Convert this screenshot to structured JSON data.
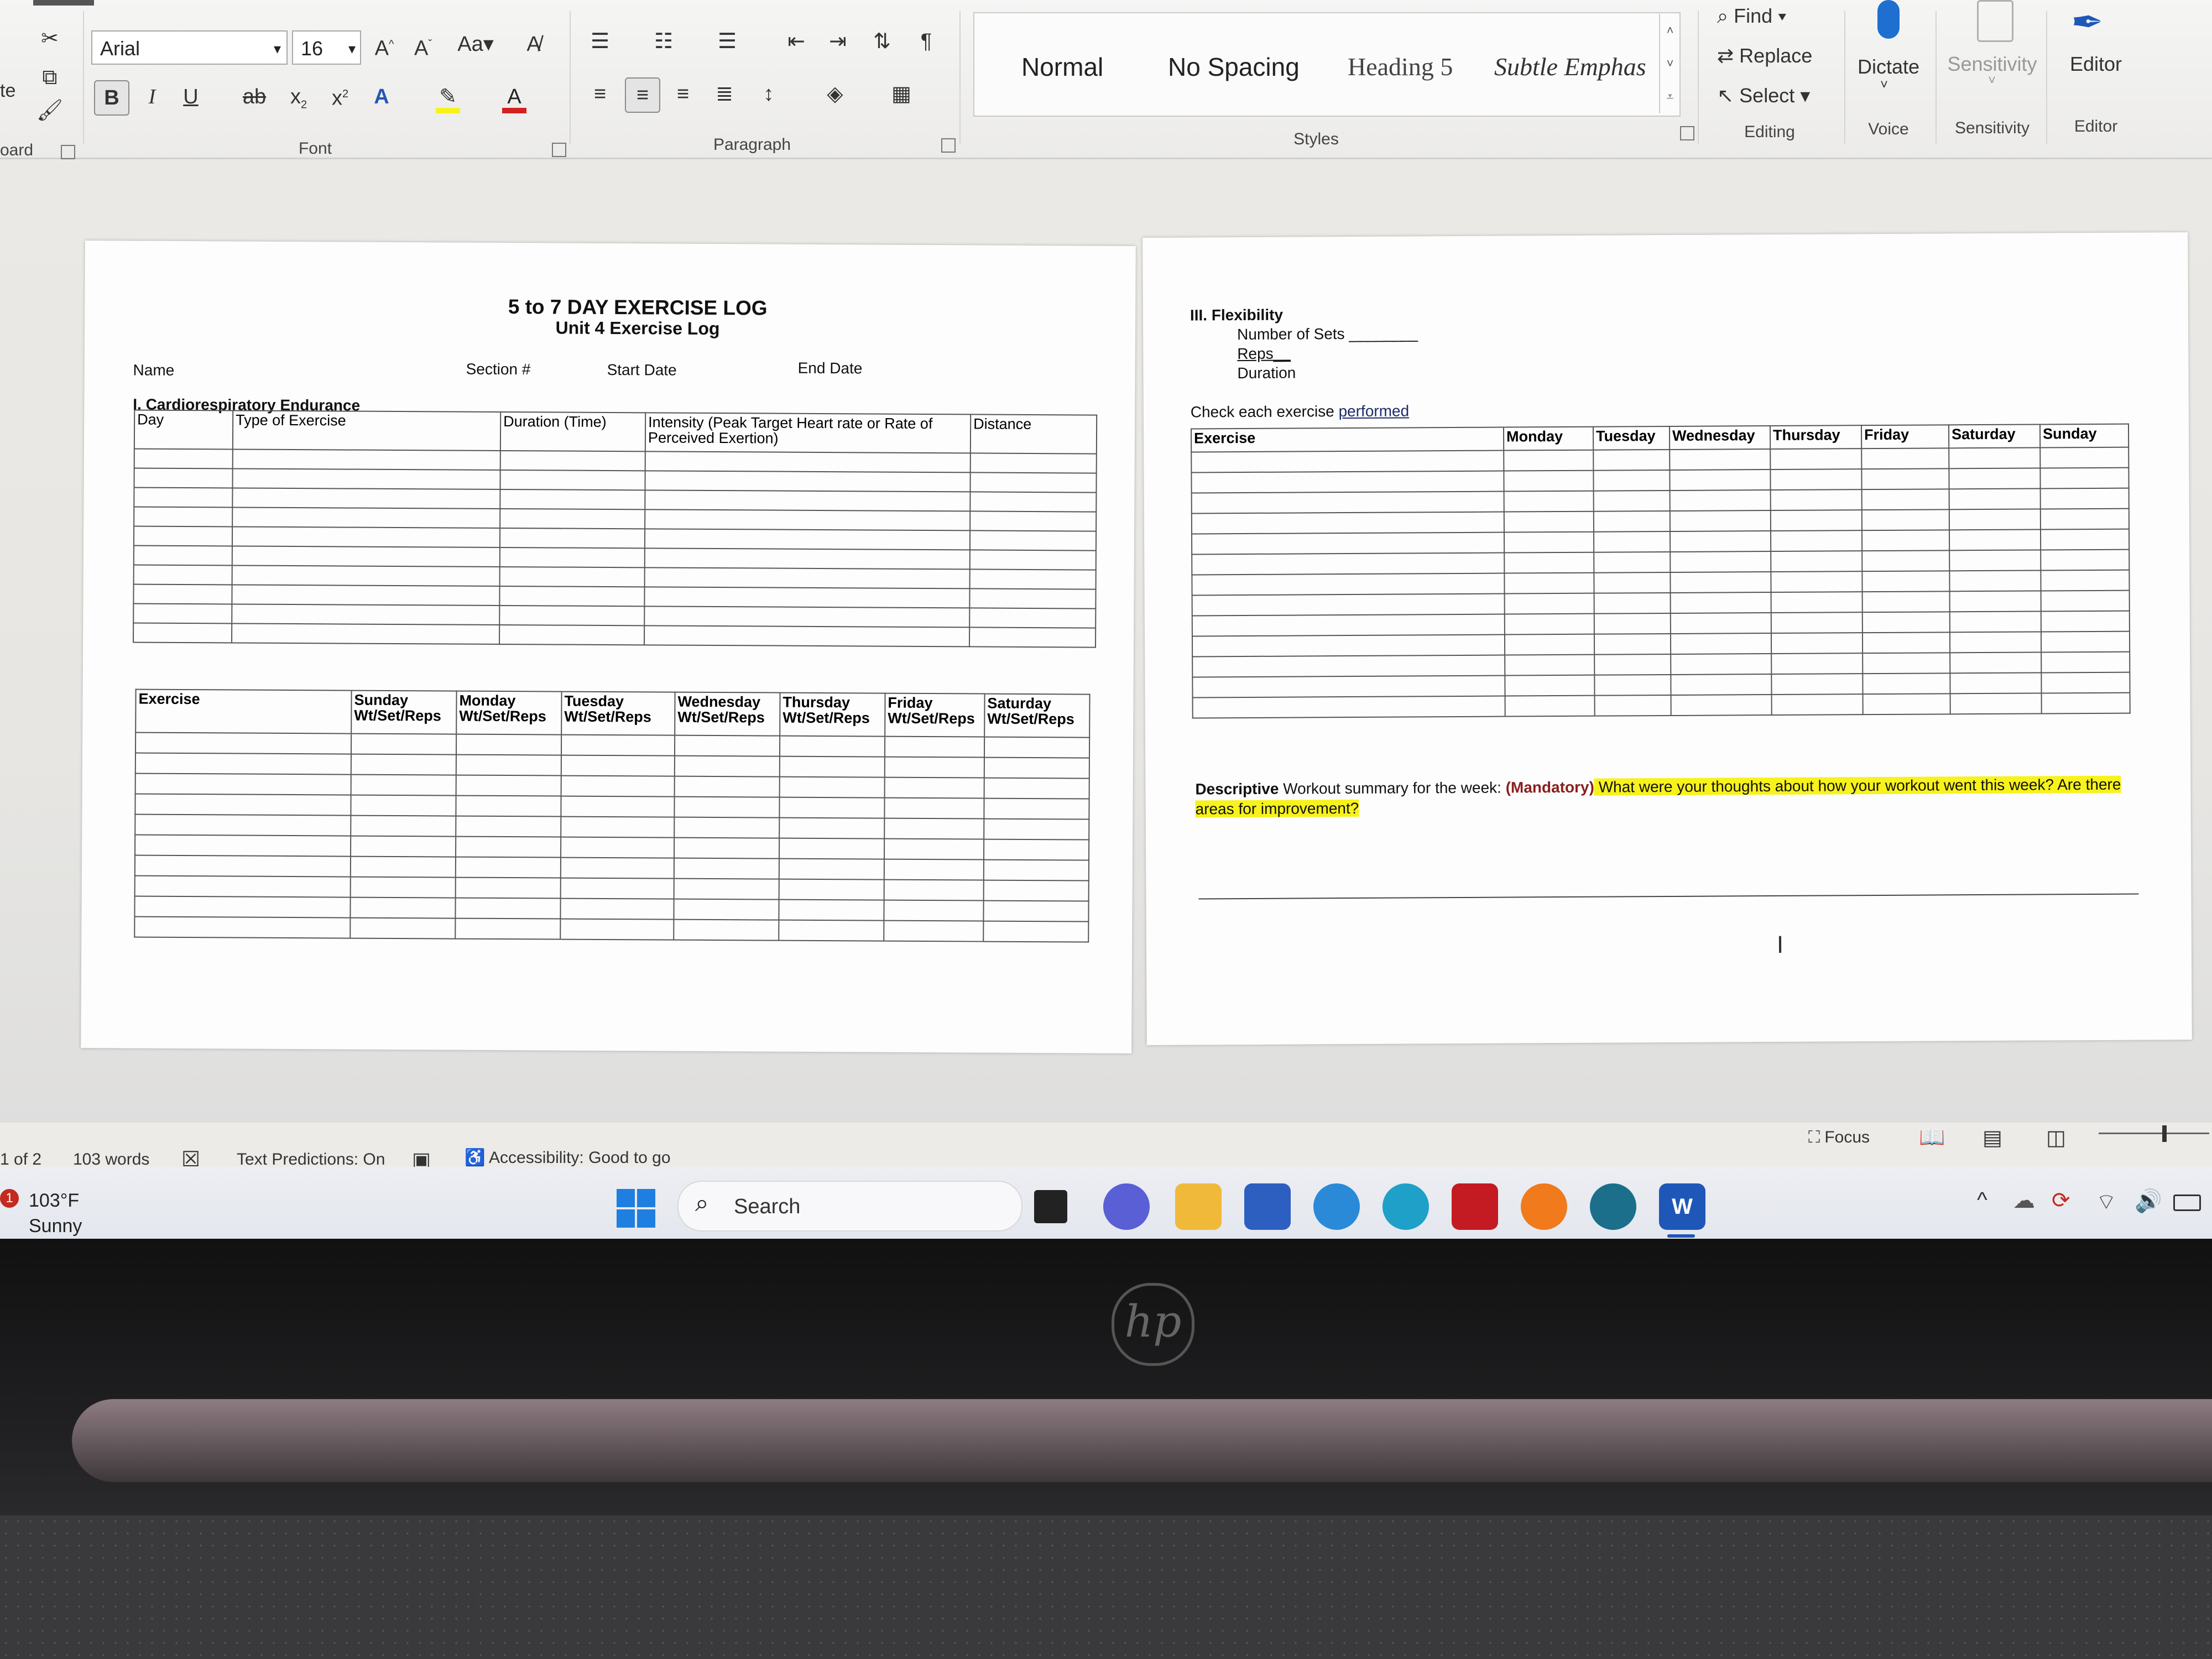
{
  "ribbon": {
    "clipboard": {
      "label": "oard",
      "paste_label": "te"
    },
    "font": {
      "name": "Arial",
      "size": "16",
      "label": "Font",
      "case_label": "Aa"
    },
    "paragraph": {
      "label": "Paragraph"
    },
    "styles": {
      "label": "Styles",
      "items": [
        "Normal",
        "No Spacing",
        "Heading 5",
        "Subtle Emphas"
      ]
    },
    "editing": {
      "label": "Editing",
      "find": "Find",
      "replace": "Replace",
      "select": "Select"
    },
    "voice": {
      "label": "Voice",
      "dictate": "Dictate"
    },
    "sensitivity": {
      "label": "Sensitivity",
      "button": "Sensitivity"
    },
    "editor": {
      "label": "Editor",
      "button": "Editor"
    },
    "colors": {
      "font_color": "#d42020",
      "highlight": "#f7f21b",
      "dictate": "#1e6fd0",
      "editor": "#1f57b8"
    }
  },
  "doc_left": {
    "title": "5 to 7 DAY EXERCISE LOG",
    "subtitle": "Unit 4 Exercise Log",
    "fields": {
      "name": "Name",
      "section": "Section #",
      "start": "Start Date",
      "end": "End Date"
    },
    "cardio": {
      "heading": "I. Cardiorespiratory Endurance",
      "headers": [
        "Day",
        "Type of Exercise",
        "Duration (Time)",
        "Intensity (Peak Target Heart rate or Rate of Perceived Exertion)",
        "Distance"
      ]
    },
    "strength": {
      "headers": [
        "Exercise",
        "Sunday Wt/Set/Reps",
        "Monday Wt/Set/Reps",
        "Tuesday Wt/Set/Reps",
        "Wednesday Wt/Set/Reps",
        "Thursday Wt/Set/Reps",
        "Friday Wt/Set/Reps",
        "Saturday Wt/Set/Reps"
      ]
    }
  },
  "doc_right": {
    "heading": "III. Flexibility",
    "sets": "Number of Sets ________",
    "reps": "Reps__",
    "duration": "Duration",
    "check_prefix": "Check each exercise ",
    "check_word": "performed",
    "flex_headers": [
      "Exercise",
      "Monday",
      "Tuesday",
      "Wednesday",
      "Thursday",
      "Friday",
      "Saturday",
      "Sunday"
    ],
    "summary": {
      "bold": "Descriptive",
      "text": " Workout summary for the week: ",
      "mandatory": "(Mandatory)",
      "question": " What were your thoughts about how your workout went this week?  Are there areas for improvement?"
    }
  },
  "status": {
    "page": "1 of 2",
    "words": "103 words",
    "predictions": "Text Predictions: On",
    "accessibility": "Accessibility: Good to go",
    "focus": "Focus"
  },
  "taskbar": {
    "weather_temp": "103°F",
    "weather_desc": "Sunny",
    "badge": "1",
    "search": "Search"
  },
  "brand": "hp"
}
